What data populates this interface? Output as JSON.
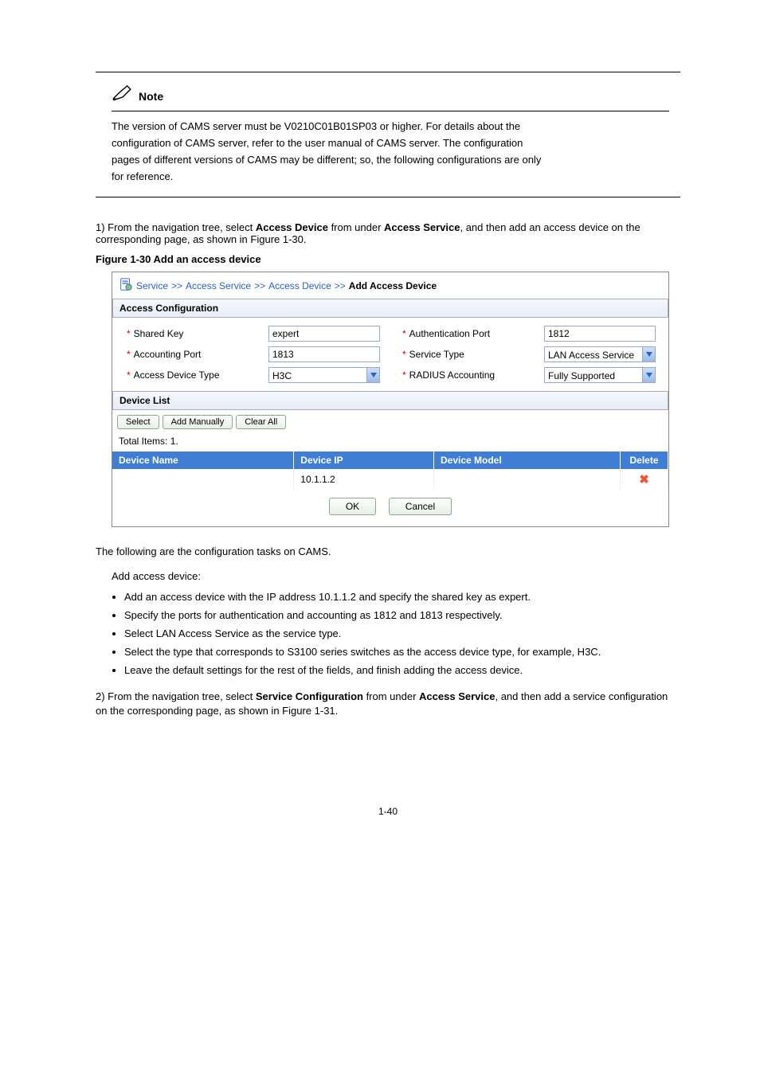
{
  "note": {
    "label": "Note",
    "lines": [
      "The version of CAMS server must be V0210C01B01SP03 or higher. For details about the",
      "configuration of CAMS server, refer to the user manual of CAMS server. The configuration",
      "pages of different versions of CAMS may be different; so, the following configurations are only",
      "for reference."
    ]
  },
  "figcaption": "Figure 1-30 Add an access device",
  "crumb": {
    "a": "Service",
    "b": "Access Service",
    "c": "Access Device",
    "d": "Add Access Device"
  },
  "access_cfg": {
    "header": "Access Configuration",
    "l_sharedkey": "Shared Key",
    "v_sharedkey": "expert",
    "l_authport": "Authentication Port",
    "v_authport": "1812",
    "l_acctport": "Accounting Port",
    "v_acctport": "1813",
    "l_svctype": "Service Type",
    "v_svctype": "LAN Access Service",
    "l_devtype": "Access Device Type",
    "v_devtype": "H3C",
    "l_radacct": "RADIUS Accounting",
    "v_radacct": "Fully Supported"
  },
  "device_list": {
    "header": "Device List",
    "btn_select": "Select",
    "btn_addman": "Add Manually",
    "btn_clear": "Clear All",
    "total": "Total Items: 1.",
    "th_name": "Device Name",
    "th_ip": "Device IP",
    "th_model": "Device Model",
    "th_del": "Delete",
    "row_ip": "10.1.1.2"
  },
  "ok": "OK",
  "cancel": "Cancel",
  "body": {
    "intro": "The following are the configuration tasks on CAMS.",
    "step1_a": "1) From the navigation tree, select ",
    "step1_b": "Access Device",
    "step1_c": " from under ",
    "step1_d": "Access Service",
    "step1_e": ", and then add an access device on the corresponding page, as shown in ",
    "step1_f": "Figure 1-30",
    "step1_g": ".",
    "bullets": [
      "Add an access device with the IP address 10.1.1.2 and specify the shared key as expert.",
      "Specify the ports for authentication and accounting as 1812 and 1813 respectively.",
      "Select LAN Access Service as the service type.",
      "Select the type that corresponds to S3100 series switches as the access device type, for example, H3C.",
      "Leave the default settings for the rest of the fields, and finish adding the access device."
    ],
    "step2_a": "2) From the navigation tree, select ",
    "step2_b": "Service Configuration",
    "step2_c": " from under ",
    "step2_d": "Access Service",
    "step2_e": ", and then add a service configuration on the corresponding page, as shown in ",
    "step2_f": "Figure 1-31",
    "step2_g": "."
  },
  "pgnum": "1-40"
}
